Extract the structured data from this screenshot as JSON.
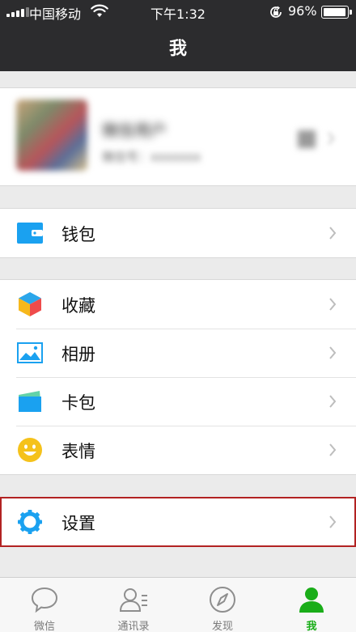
{
  "status_bar": {
    "carrier": "中国移动",
    "time": "下午1:32",
    "battery_percent": "96%",
    "battery_level": 0.96
  },
  "nav": {
    "title": "我"
  },
  "profile": {
    "name": "微信用户",
    "wechat_id": "微信号：xxxxxxx"
  },
  "menu": {
    "wallet": {
      "label": "钱包",
      "icon": "wallet-icon",
      "color": "#1aa1f0"
    },
    "favorites": {
      "label": "收藏",
      "icon": "favorites-cube-icon"
    },
    "album": {
      "label": "相册",
      "icon": "album-icon",
      "color": "#1aa1f0"
    },
    "card_package": {
      "label": "卡包",
      "icon": "card-package-icon",
      "color": "#1aa1f0"
    },
    "stickers": {
      "label": "表情",
      "icon": "smiley-icon",
      "color": "#f5c21b"
    },
    "settings": {
      "label": "设置",
      "icon": "gear-icon",
      "color": "#1aa1f0"
    }
  },
  "tabbar": {
    "tabs": [
      {
        "label": "微信",
        "icon": "chat-bubble-icon",
        "active": false
      },
      {
        "label": "通讯录",
        "icon": "contacts-icon",
        "active": false
      },
      {
        "label": "发现",
        "icon": "compass-icon",
        "active": false
      },
      {
        "label": "我",
        "icon": "person-icon",
        "active": true
      }
    ],
    "active_color": "#1aad19"
  }
}
